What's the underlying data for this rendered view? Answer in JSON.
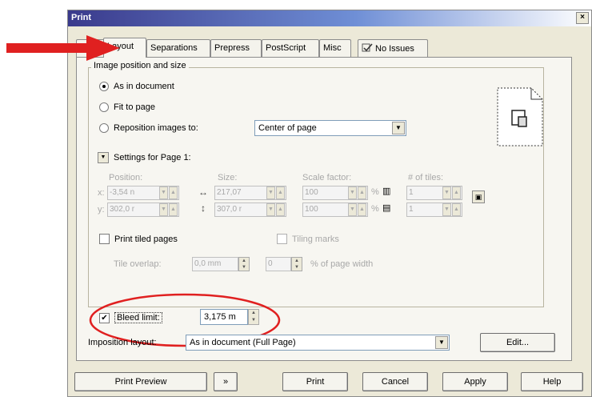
{
  "window": {
    "title": "Print",
    "close_glyph": "×"
  },
  "tabs": [
    {
      "label": "ral",
      "active": false
    },
    {
      "label": "Layout",
      "active": true
    },
    {
      "label": "Separations",
      "active": false
    },
    {
      "label": "Prepress",
      "active": false
    },
    {
      "label": "PostScript",
      "active": false
    },
    {
      "label": "Misc",
      "active": false
    },
    {
      "label": "No Issues",
      "active": false
    }
  ],
  "image_position": {
    "group_title": "Image position and size",
    "options": [
      {
        "label": "As in document",
        "checked": true
      },
      {
        "label": "Fit to page",
        "checked": false
      },
      {
        "label": "Reposition images to:",
        "checked": false
      }
    ],
    "reposition_value": "Center of page"
  },
  "settings": {
    "label": "Settings for Page 1:",
    "position_label": "Position:",
    "size_label": "Size:",
    "scale_label": "Scale factor:",
    "tiles_label": "# of tiles:",
    "x_label": "x:",
    "y_label": "y:",
    "pos_x": "-3,54 n",
    "pos_y": "302,0 r",
    "size_w": "217,07",
    "size_h": "307,0 r",
    "scale_1": "100",
    "scale_2": "100",
    "percent": "%",
    "tiles_1": "1",
    "tiles_2": "1"
  },
  "tiling": {
    "print_tiled_label": "Print tiled pages",
    "print_tiled_checked": false,
    "tiling_marks_label": "Tiling marks",
    "tile_overlap_label": "Tile overlap:",
    "tile_overlap_value": "0,0 mm",
    "overlap_percent_value": "0",
    "overlap_percent_label": "% of page width"
  },
  "bleed": {
    "label": "Bleed limit:",
    "checked": true,
    "value": "3,175 m",
    "check_glyph": "✔"
  },
  "imposition": {
    "label": "Imposition layout:",
    "value": "As in document (Full Page)",
    "edit_label": "Edit..."
  },
  "footer": {
    "print_preview": "Print Preview",
    "print": "Print",
    "cancel": "Cancel",
    "apply": "Apply",
    "help": "Help"
  },
  "colors": {
    "arrow": "#e02020",
    "highlight": "#e02020",
    "titlebar": "#3a3a8c"
  }
}
